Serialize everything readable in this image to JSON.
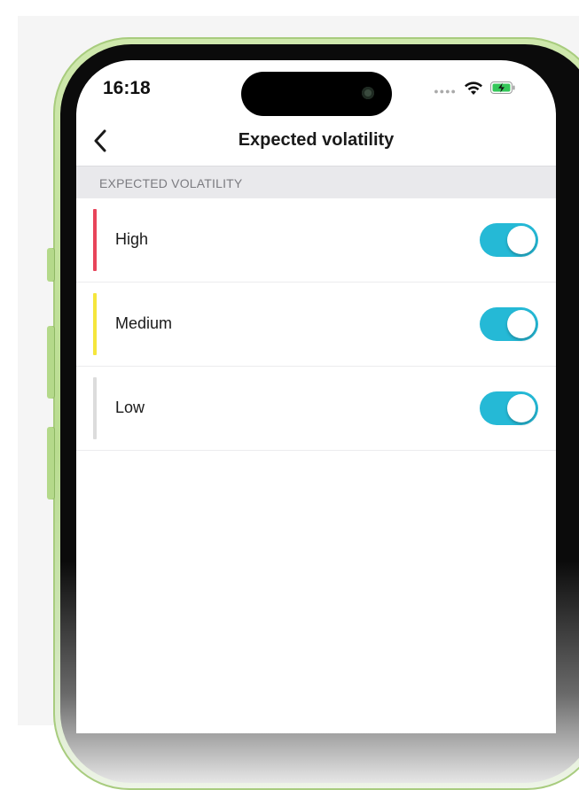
{
  "status_bar": {
    "time": "16:18",
    "signal_icon": "signal-dots-icon",
    "wifi_icon": "wifi-icon",
    "battery_icon": "battery-charging-icon"
  },
  "nav": {
    "back_icon": "chevron-left-icon",
    "title": "Expected volatility"
  },
  "section": {
    "header": "EXPECTED VOLATILITY"
  },
  "items": [
    {
      "label": "High",
      "indicator_color": "#e8445a",
      "enabled": true
    },
    {
      "label": "Medium",
      "indicator_color": "#f5e63c",
      "enabled": true
    },
    {
      "label": "Low",
      "indicator_color": "#dcdcdc",
      "enabled": true
    }
  ],
  "colors": {
    "toggle_on": "#25b9d6",
    "phone_frame": "#c3e29a"
  }
}
